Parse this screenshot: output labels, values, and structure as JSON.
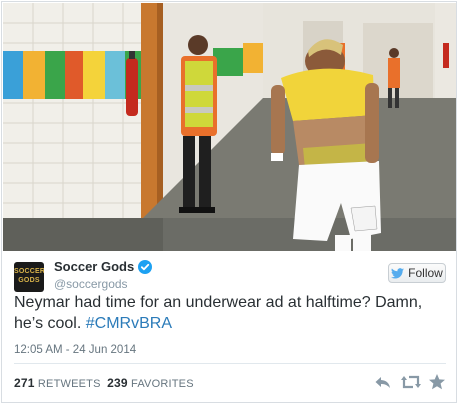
{
  "photo": {
    "description_icon": "photo-image"
  },
  "author": {
    "avatar_text": "SOCCER GODS",
    "display_name": "Soccer Gods",
    "handle": "@soccergods",
    "verified_icon": "verified-badge-icon"
  },
  "follow_button": {
    "label": "Follow",
    "icon": "twitter-bird-icon"
  },
  "tweet": {
    "text_before": "Neymar had time for an underwear ad at halftime? Damn, he’s cool. ",
    "hashtag": "#CMRvBRA",
    "timestamp": "12:05 AM - 24 Jun 2014"
  },
  "stats": {
    "retweets_count": "271",
    "retweets_label": "RETWEETS",
    "favorites_count": "239",
    "favorites_label": "FAVORITES"
  },
  "actions": {
    "reply_icon": "reply-icon",
    "retweet_icon": "retweet-icon",
    "favorite_icon": "star-icon"
  },
  "colors": {
    "link": "#2b7bb9",
    "text": "#292f33",
    "muted": "#66757f",
    "verified": "#1da1f2"
  }
}
